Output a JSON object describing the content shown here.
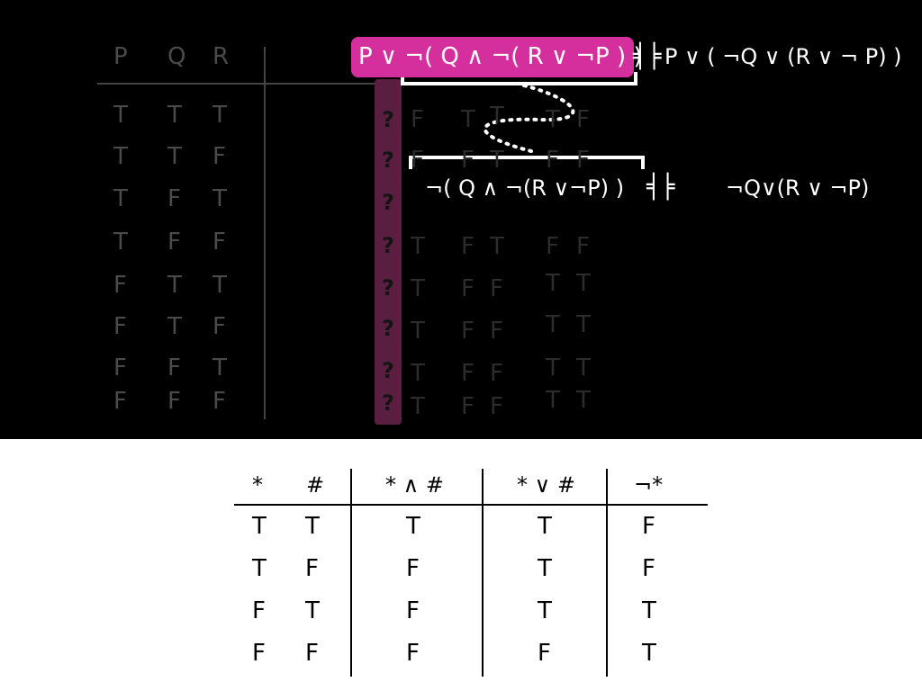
{
  "dim_table": {
    "headers": [
      "P",
      "Q",
      "R"
    ],
    "rows": [
      [
        "T",
        "T",
        "T"
      ],
      [
        "T",
        "T",
        "F"
      ],
      [
        "T",
        "F",
        "T"
      ],
      [
        "T",
        "F",
        "F"
      ],
      [
        "F",
        "T",
        "T"
      ],
      [
        "F",
        "T",
        "F"
      ],
      [
        "F",
        "F",
        "T"
      ],
      [
        "F",
        "F",
        "F"
      ]
    ],
    "question_marks": [
      "?",
      "?",
      "?",
      "?",
      "?",
      "?",
      "?",
      "?"
    ],
    "faint_values": [
      [
        "F",
        "T",
        "T",
        "",
        "T",
        "F"
      ],
      [
        "F",
        "F",
        "T",
        "F",
        "F",
        ""
      ],
      [
        "",
        "",
        "",
        "",
        "",
        ""
      ],
      [
        "T",
        "F",
        "T",
        "F",
        "F",
        ""
      ],
      [
        "T",
        "F",
        "F",
        "T",
        "T",
        ""
      ],
      [
        "T",
        "F",
        "F",
        "T",
        "T",
        ""
      ],
      [
        "T",
        "F",
        "F",
        "T",
        "T",
        ""
      ],
      [
        "T",
        "F",
        "F",
        "T",
        "T",
        ""
      ]
    ]
  },
  "formulas": {
    "main": "P ∨ ¬( Q ∧ ¬( R ∨ ¬P ) )",
    "equiv_symbol": "╡╞",
    "main_rhs": "P ∨ ( ¬Q ∨ (R ∨ ¬ P) )",
    "sub_lhs": "¬( Q ∧ ¬(R ∨¬P) )",
    "sub_equiv": "╡╞",
    "sub_rhs": "¬Q∨(R ∨ ¬P)"
  },
  "colors": {
    "highlight": "#d42f9c",
    "column_highlight": "#5a1f40",
    "panel_bg": "#000000"
  },
  "bottom_table": {
    "headers": [
      "*",
      "#",
      "* ∧ #",
      "* ∨ #",
      "¬*"
    ],
    "rows": [
      [
        "T",
        "T",
        "T",
        "T",
        "F"
      ],
      [
        "T",
        "F",
        "F",
        "T",
        "F"
      ],
      [
        "F",
        "T",
        "F",
        "T",
        "T"
      ],
      [
        "F",
        "F",
        "F",
        "F",
        "T"
      ]
    ]
  }
}
